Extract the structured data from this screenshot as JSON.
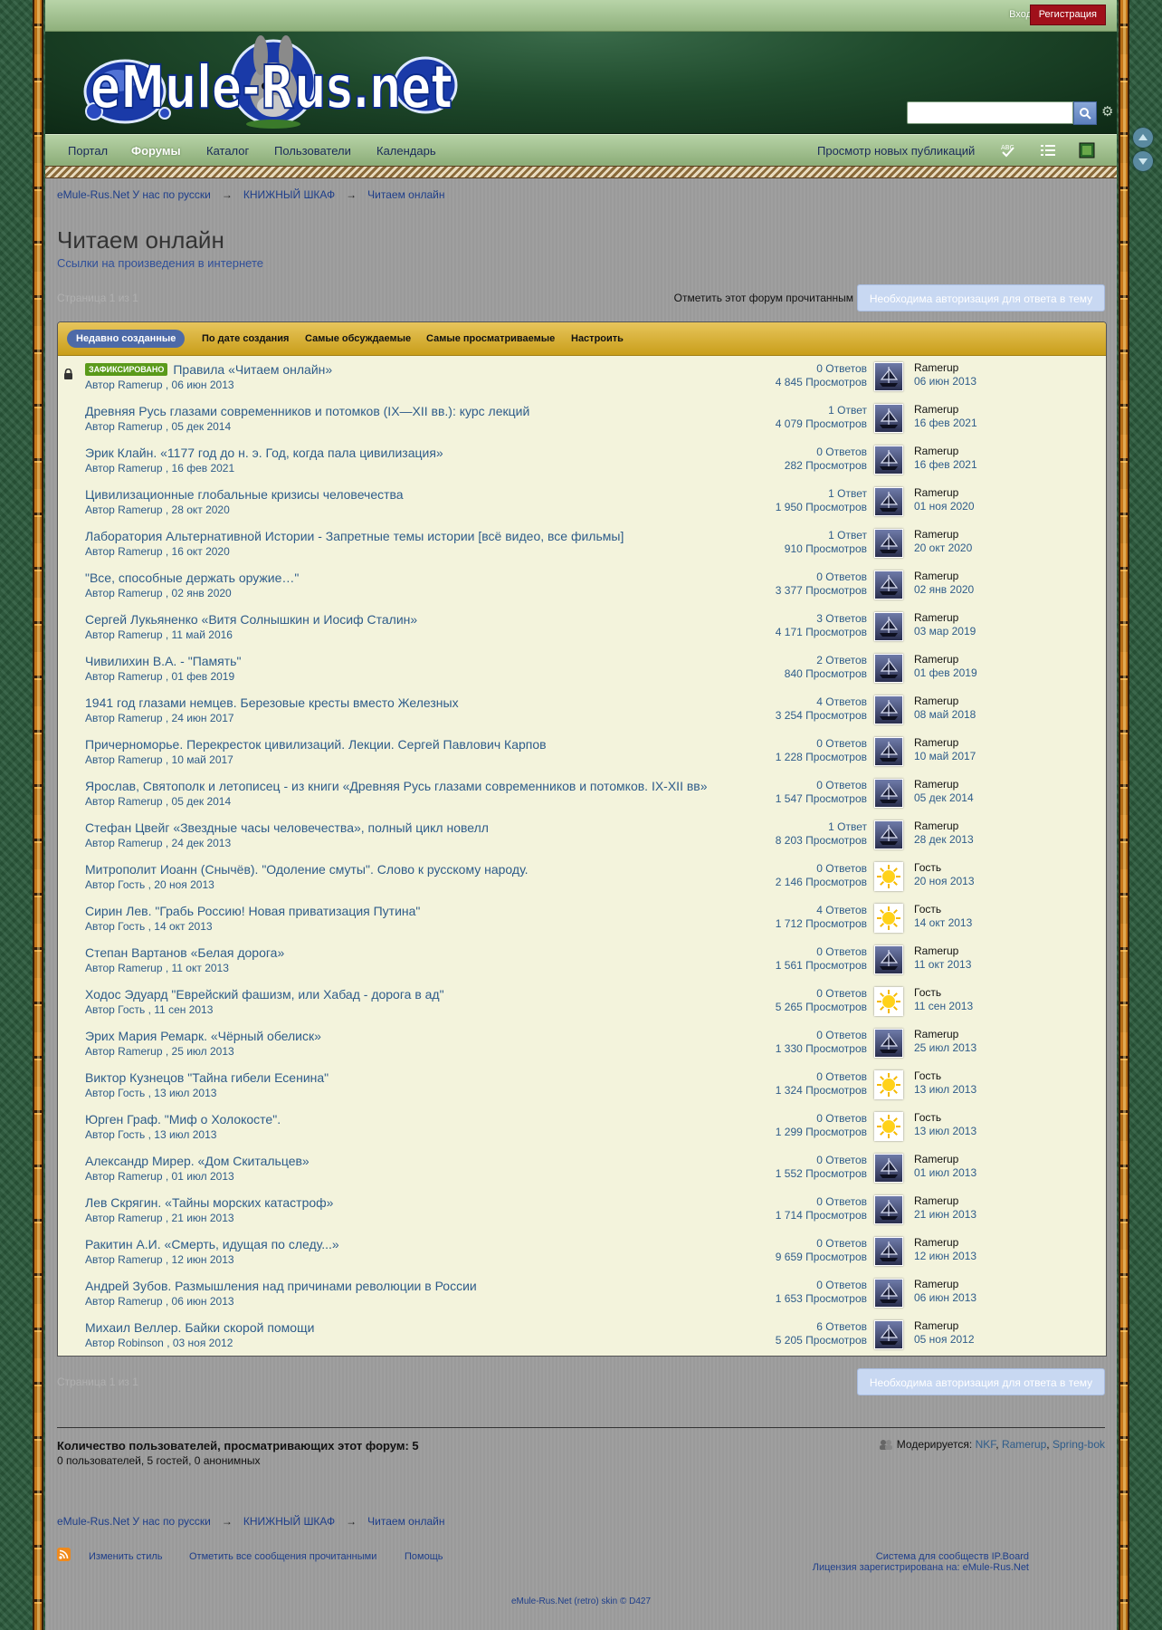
{
  "header": {
    "login_label": "Вход",
    "register_label": "Регистрация",
    "logo_text": "eMule-Rus.net"
  },
  "nav": {
    "items": [
      "Портал",
      "Форумы",
      "Каталог",
      "Пользователи",
      "Календарь"
    ],
    "active_index": 1,
    "new_posts": "Просмотр новых публикаций"
  },
  "breadcrumb": [
    "eMule-Rus.Net У нас по русски",
    "КНИЖНЫЙ ШКАФ",
    "Читаем онлайн"
  ],
  "forum": {
    "title": "Читаем онлайн",
    "description": "Ссылки на произведения в интернете",
    "pagination": "Страница 1 из 1",
    "mark_read": "Отметить этот форум прочитанным",
    "reply_button": "Необходима авторизация для ответа в тему"
  },
  "sort": {
    "active": "Недавно созданные",
    "options": [
      "По дате создания",
      "Самые обсуждаемые",
      "Самые просматриваемые",
      "Настроить"
    ]
  },
  "pinned_label": "ЗАФИКСИРОВАНО",
  "topics": [
    {
      "title": "Правила «Читаем онлайн»",
      "meta": "Автор Ramerup , 06 июн 2013",
      "replies": "0 Ответов",
      "views": "4 845 Просмотров",
      "last_user": "Ramerup",
      "last_date": "06 июн 2013",
      "avatar": "ship",
      "pinned": true,
      "locked": true
    },
    {
      "title": "Древняя Русь глазами современников и потомков (IX—XII вв.): курс лекций",
      "meta": "Автор Ramerup , 05 дек 2014",
      "replies": "1 Ответ",
      "views": "4 079 Просмотров",
      "last_user": "Ramerup",
      "last_date": "16 фев 2021",
      "avatar": "ship"
    },
    {
      "title": "Эрик Клайн. «1177 год до н. э. Год, когда пала цивилизация»",
      "meta": "Автор Ramerup , 16 фев 2021",
      "replies": "0 Ответов",
      "views": "282 Просмотров",
      "last_user": "Ramerup",
      "last_date": "16 фев 2021",
      "avatar": "ship"
    },
    {
      "title": "Цивилизационные глобальные кризисы человечества",
      "meta": "Автор Ramerup , 28 окт 2020",
      "replies": "1 Ответ",
      "views": "1 950 Просмотров",
      "last_user": "Ramerup",
      "last_date": "01 ноя 2020",
      "avatar": "ship"
    },
    {
      "title": "Лаборатория Альтернативной Истории - Запретные темы истории [всё видео, все фильмы]",
      "meta": "Автор Ramerup , 16 окт 2020",
      "replies": "1 Ответ",
      "views": "910 Просмотров",
      "last_user": "Ramerup",
      "last_date": "20 окт 2020",
      "avatar": "ship"
    },
    {
      "title": "\"Все, способные держать оружие…\"",
      "meta": "Автор Ramerup , 02 янв 2020",
      "replies": "0 Ответов",
      "views": "3 377 Просмотров",
      "last_user": "Ramerup",
      "last_date": "02 янв 2020",
      "avatar": "ship"
    },
    {
      "title": "Сергей Лукьяненко «Витя Солнышкин и Иосиф Сталин»",
      "meta": "Автор Ramerup , 11 май 2016",
      "replies": "3 Ответов",
      "views": "4 171 Просмотров",
      "last_user": "Ramerup",
      "last_date": "03 мар 2019",
      "avatar": "ship"
    },
    {
      "title": "Чивилихин В.А. - \"Память\"",
      "meta": "Автор Ramerup , 01 фев 2019",
      "replies": "2 Ответов",
      "views": "840 Просмотров",
      "last_user": "Ramerup",
      "last_date": "01 фев 2019",
      "avatar": "ship"
    },
    {
      "title": "1941 год глазами немцев. Березовые кресты вместо Железных",
      "meta": "Автор Ramerup , 24 июн 2017",
      "replies": "4 Ответов",
      "views": "3 254 Просмотров",
      "last_user": "Ramerup",
      "last_date": "08 май 2018",
      "avatar": "ship"
    },
    {
      "title": "Причерноморье. Перекресток цивилизаций. Лекции. Сергей Павлович Карпов",
      "meta": "Автор Ramerup , 10 май 2017",
      "replies": "0 Ответов",
      "views": "1 228 Просмотров",
      "last_user": "Ramerup",
      "last_date": "10 май 2017",
      "avatar": "ship"
    },
    {
      "title": "Ярослав, Святополк и летописец - из книги «Древняя Русь глазами современников и потомков. IX-XII вв»",
      "meta": "Автор Ramerup , 05 дек 2014",
      "replies": "0 Ответов",
      "views": "1 547 Просмотров",
      "last_user": "Ramerup",
      "last_date": "05 дек 2014",
      "avatar": "ship"
    },
    {
      "title": "Стефан Цвейг «Звездные часы человечества», полный цикл новелл",
      "meta": "Автор Ramerup , 24 дек 2013",
      "replies": "1 Ответ",
      "views": "8 203 Просмотров",
      "last_user": "Ramerup",
      "last_date": "28 дек 2013",
      "avatar": "ship"
    },
    {
      "title": "Митрополит Иоанн (Снычёв). \"Одоление смуты\". Слово к русскому народу.",
      "meta": "Автор Гость , 20 ноя 2013",
      "replies": "0 Ответов",
      "views": "2 146 Просмотров",
      "last_user": "Гость",
      "last_date": "20 ноя 2013",
      "avatar": "sun"
    },
    {
      "title": "Сирин Лев. \"Грабь Россию! Новая приватизация Путина\"",
      "meta": "Автор Гость , 14 окт 2013",
      "replies": "4 Ответов",
      "views": "1 712 Просмотров",
      "last_user": "Гость",
      "last_date": "14 окт 2013",
      "avatar": "sun"
    },
    {
      "title": "Степан Вартанов «Белая дорога»",
      "meta": "Автор Ramerup , 11 окт 2013",
      "replies": "0 Ответов",
      "views": "1 561 Просмотров",
      "last_user": "Ramerup",
      "last_date": "11 окт 2013",
      "avatar": "ship"
    },
    {
      "title": "Ходос Эдуард \"Еврейский фашизм, или Хабад - дорога в ад\"",
      "meta": "Автор Гость , 11 сен 2013",
      "replies": "0 Ответов",
      "views": "5 265 Просмотров",
      "last_user": "Гость",
      "last_date": "11 сен 2013",
      "avatar": "sun"
    },
    {
      "title": "Эрих Мария Ремарк. «Чёрный обелиск»",
      "meta": "Автор Ramerup , 25 июл 2013",
      "replies": "0 Ответов",
      "views": "1 330 Просмотров",
      "last_user": "Ramerup",
      "last_date": "25 июл 2013",
      "avatar": "ship"
    },
    {
      "title": "Виктор Кузнецов \"Тайна гибели Есенина\"",
      "meta": "Автор Гость , 13 июл 2013",
      "replies": "0 Ответов",
      "views": "1 324 Просмотров",
      "last_user": "Гость",
      "last_date": "13 июл 2013",
      "avatar": "sun"
    },
    {
      "title": "Юрген Граф. \"Миф о Холокосте\".",
      "meta": "Автор Гость , 13 июл 2013",
      "replies": "0 Ответов",
      "views": "1 299 Просмотров",
      "last_user": "Гость",
      "last_date": "13 июл 2013",
      "avatar": "sun"
    },
    {
      "title": "Александр Мирер. «Дом Скитальцев»",
      "meta": "Автор Ramerup , 01 июл 2013",
      "replies": "0 Ответов",
      "views": "1 552 Просмотров",
      "last_user": "Ramerup",
      "last_date": "01 июл 2013",
      "avatar": "ship"
    },
    {
      "title": "Лев Скрягин. «Тайны морских катастроф»",
      "meta": "Автор Ramerup , 21 июн 2013",
      "replies": "0 Ответов",
      "views": "1 714 Просмотров",
      "last_user": "Ramerup",
      "last_date": "21 июн 2013",
      "avatar": "ship"
    },
    {
      "title": "Ракитин А.И. «Смерть, идущая по следу...»",
      "meta": "Автор Ramerup , 12 июн 2013",
      "replies": "0 Ответов",
      "views": "9 659 Просмотров",
      "last_user": "Ramerup",
      "last_date": "12 июн 2013",
      "avatar": "ship"
    },
    {
      "title": "Андрей Зубов. Размышления над причинами революции в России",
      "meta": "Автор Ramerup , 06 июн 2013",
      "replies": "0 Ответов",
      "views": "1 653 Просмотров",
      "last_user": "Ramerup",
      "last_date": "06 июн 2013",
      "avatar": "ship"
    },
    {
      "title": "Михаил Веллер. Байки скорой помощи",
      "meta": "Автор Robinson , 03 ноя 2012",
      "replies": "6 Ответов",
      "views": "5 205 Просмотров",
      "last_user": "Ramerup",
      "last_date": "05 ноя 2012",
      "avatar": "ship"
    }
  ],
  "viewers": {
    "title": "Количество пользователей, просматривающих этот форум: 5",
    "detail": "0 пользователей, 5 гостей, 0 анонимных"
  },
  "moderators": {
    "label": "Модерируется:",
    "names": [
      "NKF",
      "Ramerup",
      "Spring-bok"
    ]
  },
  "footer": {
    "change_style": "Изменить стиль",
    "mark_all_read": "Отметить все сообщения прочитанными",
    "help": "Помощь",
    "ipb_line1": "Система для сообществ IP.Board",
    "ipb_line2": "Лицензия зарегистрирована на: eMule-Rus.Net",
    "skin": "eMule-Rus.Net (retro) skin © D427"
  },
  "colors": {
    "accent": "#4d6aa8",
    "register": "#a0101a",
    "sortbar": "#d9b232",
    "row_bg": "#f3f3dc",
    "link": "#2e5c8a"
  }
}
